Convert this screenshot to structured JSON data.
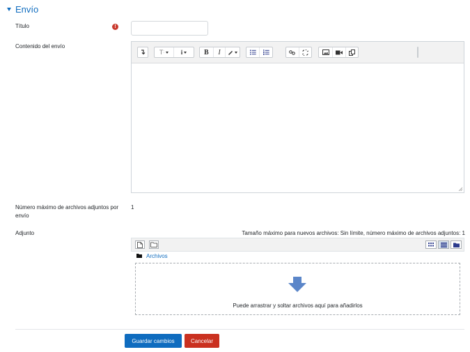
{
  "section": {
    "title": "Envío"
  },
  "fields": {
    "title_label": "Título",
    "title_value": "",
    "content_label": "Contenido del envío",
    "max_files_label": "Número máximo de archivos adjuntos por envío",
    "max_files_value": "1",
    "attachment_label": "Adjunto"
  },
  "editor": {
    "toolbar_buttons": [
      "collapse-icon",
      "paragraph-styles-icon",
      "info-icon",
      "bold-icon",
      "italic-icon",
      "text-color-icon",
      "unordered-list-icon",
      "ordered-list-icon",
      "link-icon",
      "unlink-icon",
      "image-icon",
      "media-icon",
      "manage-files-icon"
    ],
    "bold_glyph": "B",
    "italic_glyph": "I"
  },
  "filemanager": {
    "limits_text": "Tamaño máximo para nuevos archivos: Sin límite, número máximo de archivos adjuntos: 1",
    "breadcrumb": "Archivos",
    "drop_text": "Puede arrastrar y soltar archivos aquí para añadirlos"
  },
  "buttons": {
    "save": "Guardar cambios",
    "cancel": "Cancelar"
  },
  "colors": {
    "accent": "#0f6cbf",
    "danger": "#ca3120",
    "required": "#c93a2e"
  }
}
